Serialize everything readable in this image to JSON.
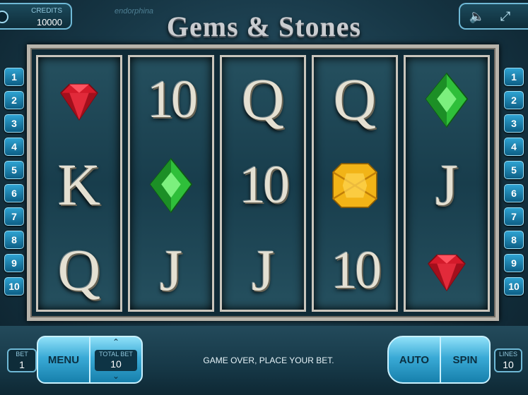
{
  "header": {
    "credits_label": "CREDITS",
    "credits_value": "10000",
    "provider": "endorphina",
    "title": "Gems & Stones"
  },
  "system_icons": [
    "sound-icon",
    "fullscreen-icon"
  ],
  "line_numbers": [
    "1",
    "2",
    "3",
    "4",
    "5",
    "6",
    "7",
    "8",
    "9",
    "10"
  ],
  "reels": [
    [
      "ruby",
      "K",
      "Q"
    ],
    [
      "10",
      "emerald",
      "J"
    ],
    [
      "Q",
      "10",
      "J"
    ],
    [
      "Q",
      "topaz",
      "10"
    ],
    [
      "emerald",
      "J",
      "ruby"
    ]
  ],
  "colors": {
    "accent": "#3aaad6",
    "background": "#173746",
    "ruby": "#d41a2a",
    "emerald": "#2fbf3a",
    "topaz": "#f2b417",
    "frame": "#b8b4ab"
  },
  "controls": {
    "bet_label": "BET",
    "bet_value": "1",
    "menu_label": "MENU",
    "total_bet_label": "TOTAL BET",
    "total_bet_value": "10",
    "message": "GAME OVER, PLACE YOUR BET.",
    "auto_label": "AUTO",
    "spin_label": "SPIN",
    "lines_label": "LINES",
    "lines_value": "10"
  }
}
